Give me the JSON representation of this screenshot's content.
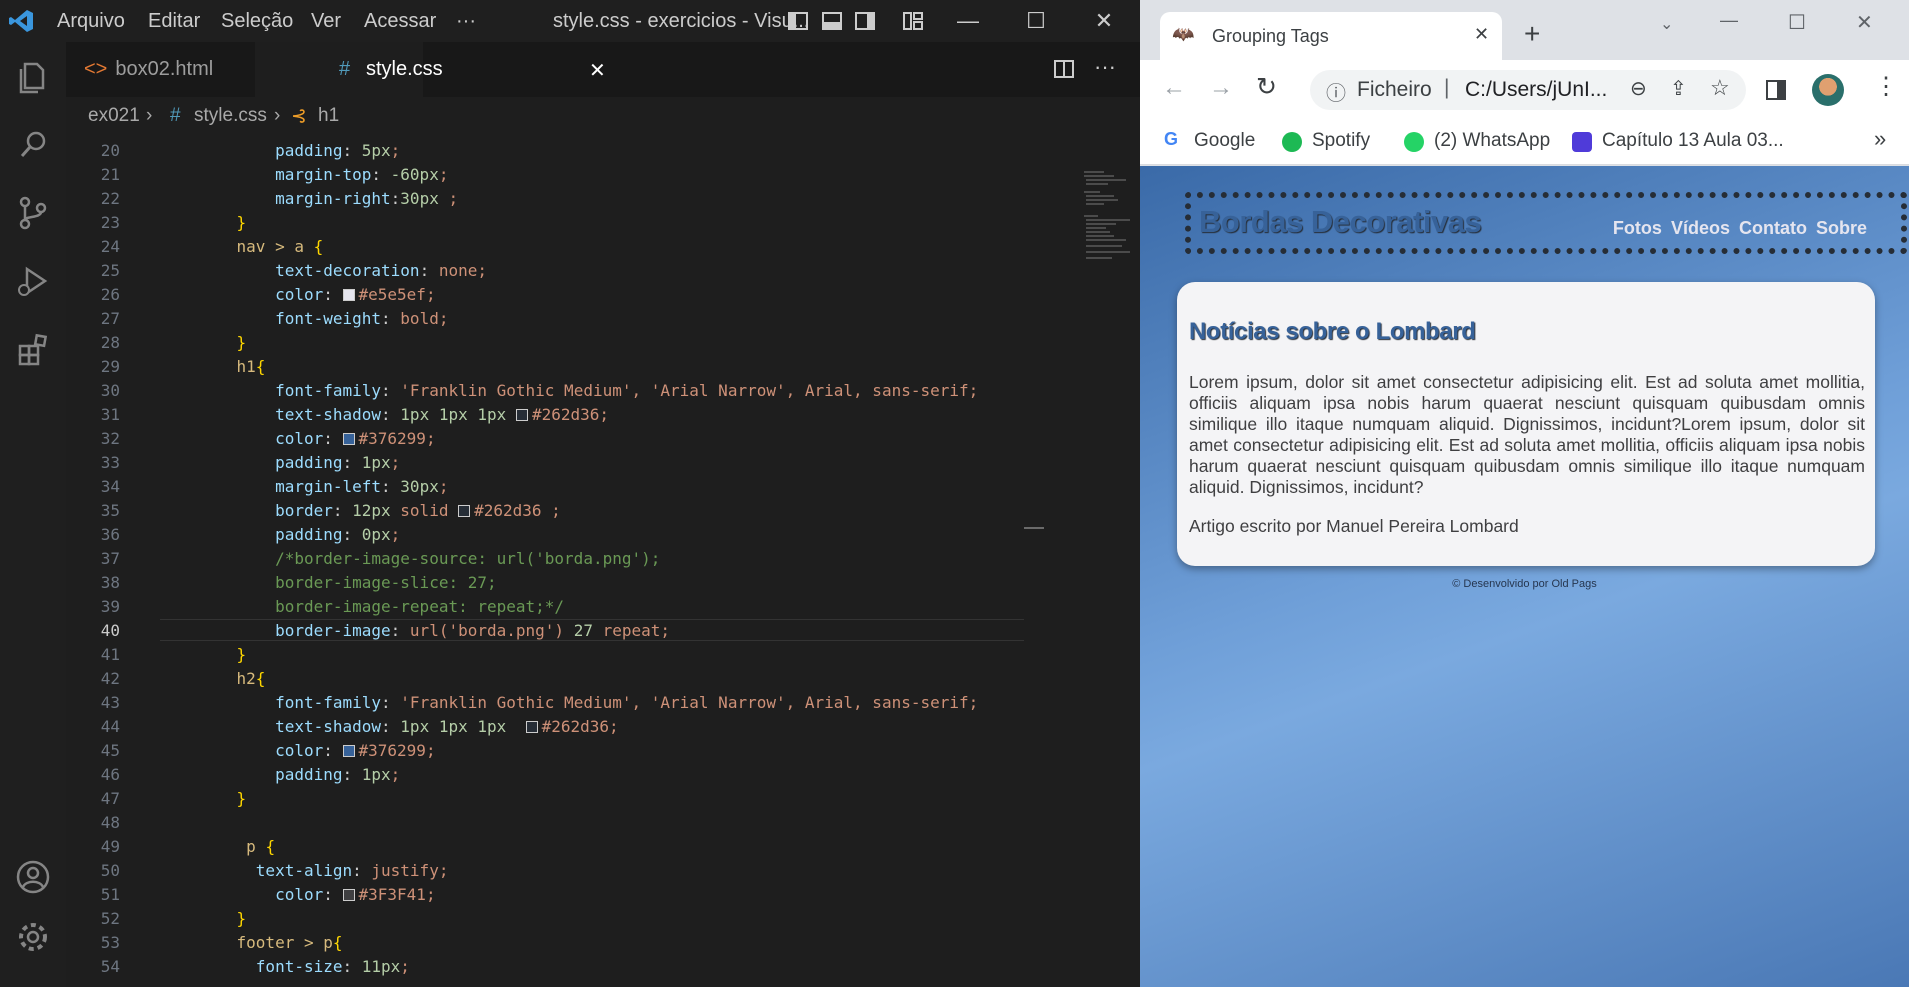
{
  "vscode": {
    "menu": [
      "Arquivo",
      "Editar",
      "Seleção",
      "Ver",
      "Acessar",
      "···"
    ],
    "window_title": "style.css - exercicios - Visu...",
    "tabs": [
      {
        "label": "box02.html",
        "icon": "html-icon"
      },
      {
        "label": "style.css",
        "icon": "css-hash-icon"
      }
    ],
    "breadcrumb": [
      "ex021",
      "style.css",
      "h1"
    ],
    "current_line": 40,
    "code_lines": [
      {
        "n": "20",
        "text": "        padding: 5px;"
      },
      {
        "n": "21",
        "text": "        margin-top: -60px;"
      },
      {
        "n": "22",
        "text": "        margin-right:30px ;"
      },
      {
        "n": "23",
        "text": "    }"
      },
      {
        "n": "24",
        "text": "    nav > a {"
      },
      {
        "n": "25",
        "text": "        text-decoration: none;"
      },
      {
        "n": "26",
        "text": "        color: #e5e5ef;"
      },
      {
        "n": "27",
        "text": "        font-weight: bold;"
      },
      {
        "n": "28",
        "text": "    }"
      },
      {
        "n": "29",
        "text": "    h1{"
      },
      {
        "n": "30",
        "text": "        font-family: 'Franklin Gothic Medium', 'Arial Narrow', Arial, sans-serif;"
      },
      {
        "n": "31",
        "text": "        text-shadow: 1px 1px 1px #262d36;"
      },
      {
        "n": "32",
        "text": "        color: #376299;"
      },
      {
        "n": "33",
        "text": "        padding: 1px;"
      },
      {
        "n": "34",
        "text": "        margin-left: 30px;"
      },
      {
        "n": "35",
        "text": "        border: 12px solid #262d36 ;"
      },
      {
        "n": "36",
        "text": "        padding: 0px;"
      },
      {
        "n": "37",
        "text": "        /*border-image-source: url('borda.png');"
      },
      {
        "n": "38",
        "text": "        border-image-slice: 27;"
      },
      {
        "n": "39",
        "text": "        border-image-repeat: repeat;*/"
      },
      {
        "n": "40",
        "text": "        border-image: url('borda.png') 27 repeat;"
      },
      {
        "n": "41",
        "text": "    }"
      },
      {
        "n": "42",
        "text": "    h2{"
      },
      {
        "n": "43",
        "text": "        font-family: 'Franklin Gothic Medium', 'Arial Narrow', Arial, sans-serif;"
      },
      {
        "n": "44",
        "text": "        text-shadow: 1px 1px 1px  #262d36;"
      },
      {
        "n": "45",
        "text": "        color: #376299;"
      },
      {
        "n": "46",
        "text": "        padding: 1px;"
      },
      {
        "n": "47",
        "text": "    }"
      },
      {
        "n": "48",
        "text": ""
      },
      {
        "n": "49",
        "text": "     p {"
      },
      {
        "n": "50",
        "text": "      text-align: justify;"
      },
      {
        "n": "51",
        "text": "        color: #3F3F41;"
      },
      {
        "n": "52",
        "text": "    }"
      },
      {
        "n": "53",
        "text": "    footer > p{"
      },
      {
        "n": "54",
        "text": "      font-size: 11px;"
      }
    ]
  },
  "chrome": {
    "tab_title": "Grouping Tags",
    "omnibox_label": "Ficheiro",
    "omnibox_url": "C:/Users/jUnI...",
    "bookmarks": [
      "Google",
      "Spotify",
      "(2) WhatsApp",
      "Capítulo 13 Aula 03..."
    ],
    "bookmarks_more": "»"
  },
  "site": {
    "title": "Bordas Decorativas",
    "nav": [
      "Fotos",
      "Vídeos",
      "Contato",
      "Sobre"
    ],
    "article_title": "Notícias sobre o Lombard",
    "paragraph": "Lorem ipsum, dolor sit amet consectetur adipisicing elit. Est ad soluta amet mollitia, officiis aliquam ipsa nobis harum quaerat nesciunt quisquam quibusdam omnis similique illo itaque numquam aliquid. Dignissimos, incidunt?Lorem ipsum, dolor sit amet consectetur adipisicing elit. Est ad soluta amet mollitia, officiis aliquam ipsa nobis harum quaerat nesciunt quisquam quibusdam omnis similique illo itaque numquam aliquid. Dignissimos, incidunt?",
    "author": "Artigo escrito por Manuel Pereira Lombard",
    "footer": "© Desenvolvido por Old Pags"
  },
  "colors": {
    "vscode_bg": "#1e1e1e",
    "h1_color": "#376299",
    "text_shadow": "#262d36",
    "nav_color": "#e5e5ef",
    "p_color": "#3F3F41"
  }
}
